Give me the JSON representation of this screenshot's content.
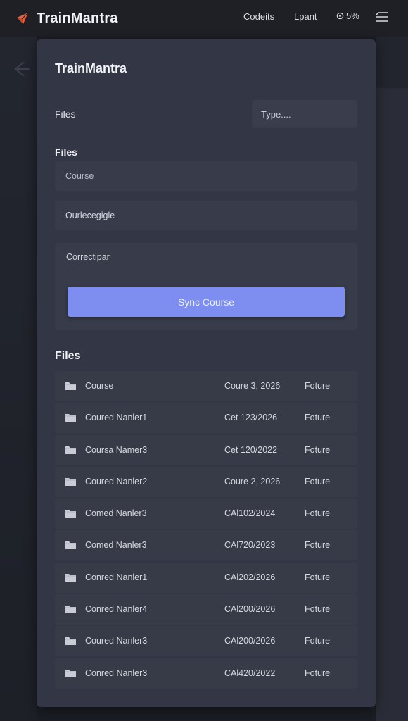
{
  "header": {
    "app_name": "TrainMantra",
    "nav": [
      "Codeits",
      "Lpant",
      "5%"
    ],
    "logo_icon": "paper-plane-icon",
    "menu_icon": "hamburger-menu-icon"
  },
  "panel": {
    "title": "TrainMantra",
    "files_label": "Files",
    "type_placeholder": "Type....",
    "section_heading": "Files",
    "course_placeholder": "Course",
    "course_value": "Ourlecegigle",
    "sync": {
      "label": "Correctipar",
      "button": "Sync Course"
    },
    "list_heading": "Files",
    "files": [
      {
        "name": "Course",
        "date": "Coure 3, 2026",
        "status": "Foture"
      },
      {
        "name": "Coured Nanler1",
        "date": "Cet 123/2026",
        "status": "Foture"
      },
      {
        "name": "Coursa Namer3",
        "date": "Cet 120/2022",
        "status": "Foture"
      },
      {
        "name": "Coured Nanler2",
        "date": "Coure 2, 2026",
        "status": "Foture"
      },
      {
        "name": "Comed Nanler3",
        "date": "CAl102/2024",
        "status": "Foture"
      },
      {
        "name": "Comed Nanler3",
        "date": "CAl720/2023",
        "status": "Foture"
      },
      {
        "name": "Conred Nanler1",
        "date": "CAl202/2026",
        "status": "Foture"
      },
      {
        "name": "Conred Nanler4",
        "date": "CAl200/2026",
        "status": "Foture"
      },
      {
        "name": "Coured Nanler3",
        "date": "CAl200/2026",
        "status": "Foture"
      },
      {
        "name": "Conred Nanler3",
        "date": "CAl420/2022",
        "status": "Foture"
      }
    ]
  },
  "colors": {
    "accent": "#7d8ef0",
    "panel_bg": "#333745",
    "topbar_bg": "#1f2026"
  }
}
